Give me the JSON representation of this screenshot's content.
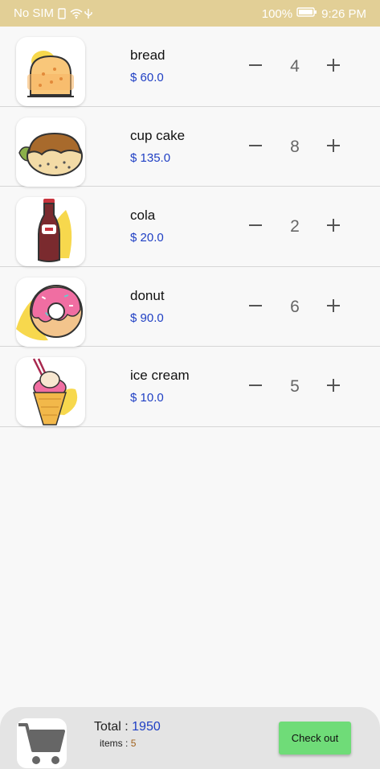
{
  "status_bar": {
    "carrier": "No SIM",
    "battery": "100%",
    "time": "9:26 PM"
  },
  "items": [
    {
      "name": "bread",
      "price": "$ 60.0",
      "qty": "4",
      "icon": "bread-icon"
    },
    {
      "name": "cup cake",
      "price": "$ 135.0",
      "qty": "8",
      "icon": "cupcake-icon"
    },
    {
      "name": "cola",
      "price": "$ 20.0",
      "qty": "2",
      "icon": "cola-icon"
    },
    {
      "name": "donut",
      "price": "$ 90.0",
      "qty": "6",
      "icon": "donut-icon"
    },
    {
      "name": "ice cream",
      "price": "$ 10.0",
      "qty": "5",
      "icon": "ice-cream-icon"
    }
  ],
  "footer": {
    "total_label": "Total :",
    "total_value": "1950",
    "items_label": "items :",
    "items_value": "5",
    "checkout_label": "Check out",
    "cart_icon": "cart-icon"
  },
  "colors": {
    "status_bar": "#e2cf96",
    "price": "#1f3fc4",
    "checkout": "#6fdc78"
  }
}
